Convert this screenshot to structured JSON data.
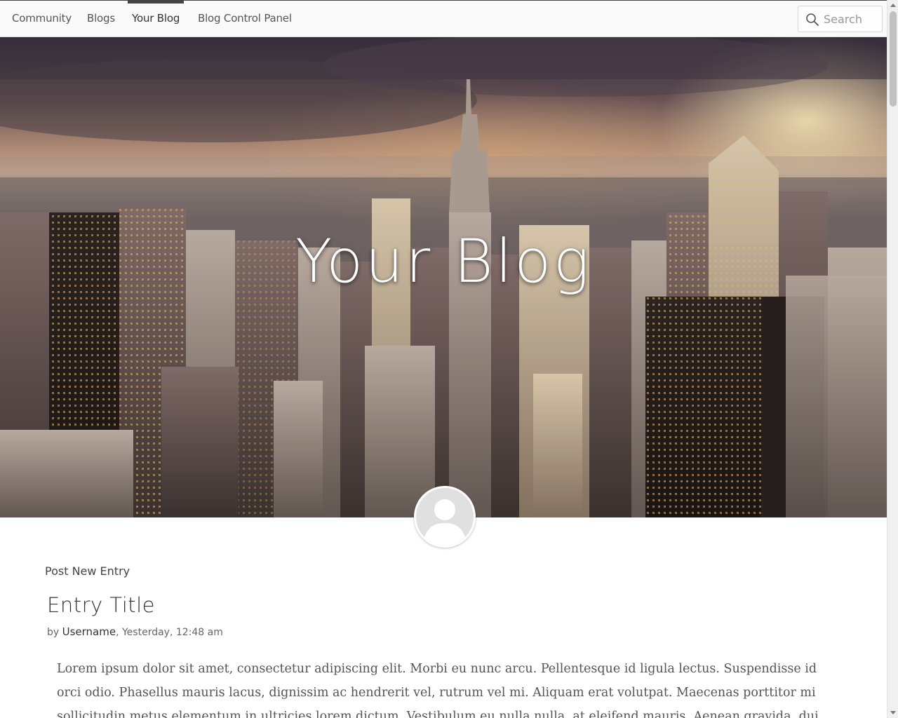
{
  "nav": {
    "items": [
      {
        "label": "Community"
      },
      {
        "label": "Blogs"
      },
      {
        "label": "Your Blog"
      },
      {
        "label": "Blog Control Panel"
      }
    ],
    "active_item": "Your Blog",
    "search_placeholder": "Search"
  },
  "hero": {
    "title": "Your Blog"
  },
  "content": {
    "post_new_label": "Post New Entry",
    "entry": {
      "title": "Entry Title",
      "by_prefix": "by ",
      "author": "Username",
      "timestamp": ", Yesterday, 12:48 am",
      "body": "Lorem ipsum dolor sit amet, consectetur adipiscing elit. Morbi eu nunc arcu. Pellentesque id ligula lectus. Suspendisse id orci odio. Phasellus mauris lacus, dignissim ac hendrerit vel, rutrum vel mi. Aliquam erat volutpat. Maecenas porttitor mi sollicitudin metus elementum in ultricies lorem dictum. Vestibulum eu nulla nulla, at eleifend mauris. Aenean gravida, dui sed"
    }
  },
  "colors": {
    "nav_background": "#fafafa",
    "active_indicator": "#444444",
    "avatar_background": "#e0e0e0"
  },
  "icons": {
    "search": "search-icon",
    "avatar": "user-silhouette-icon"
  }
}
